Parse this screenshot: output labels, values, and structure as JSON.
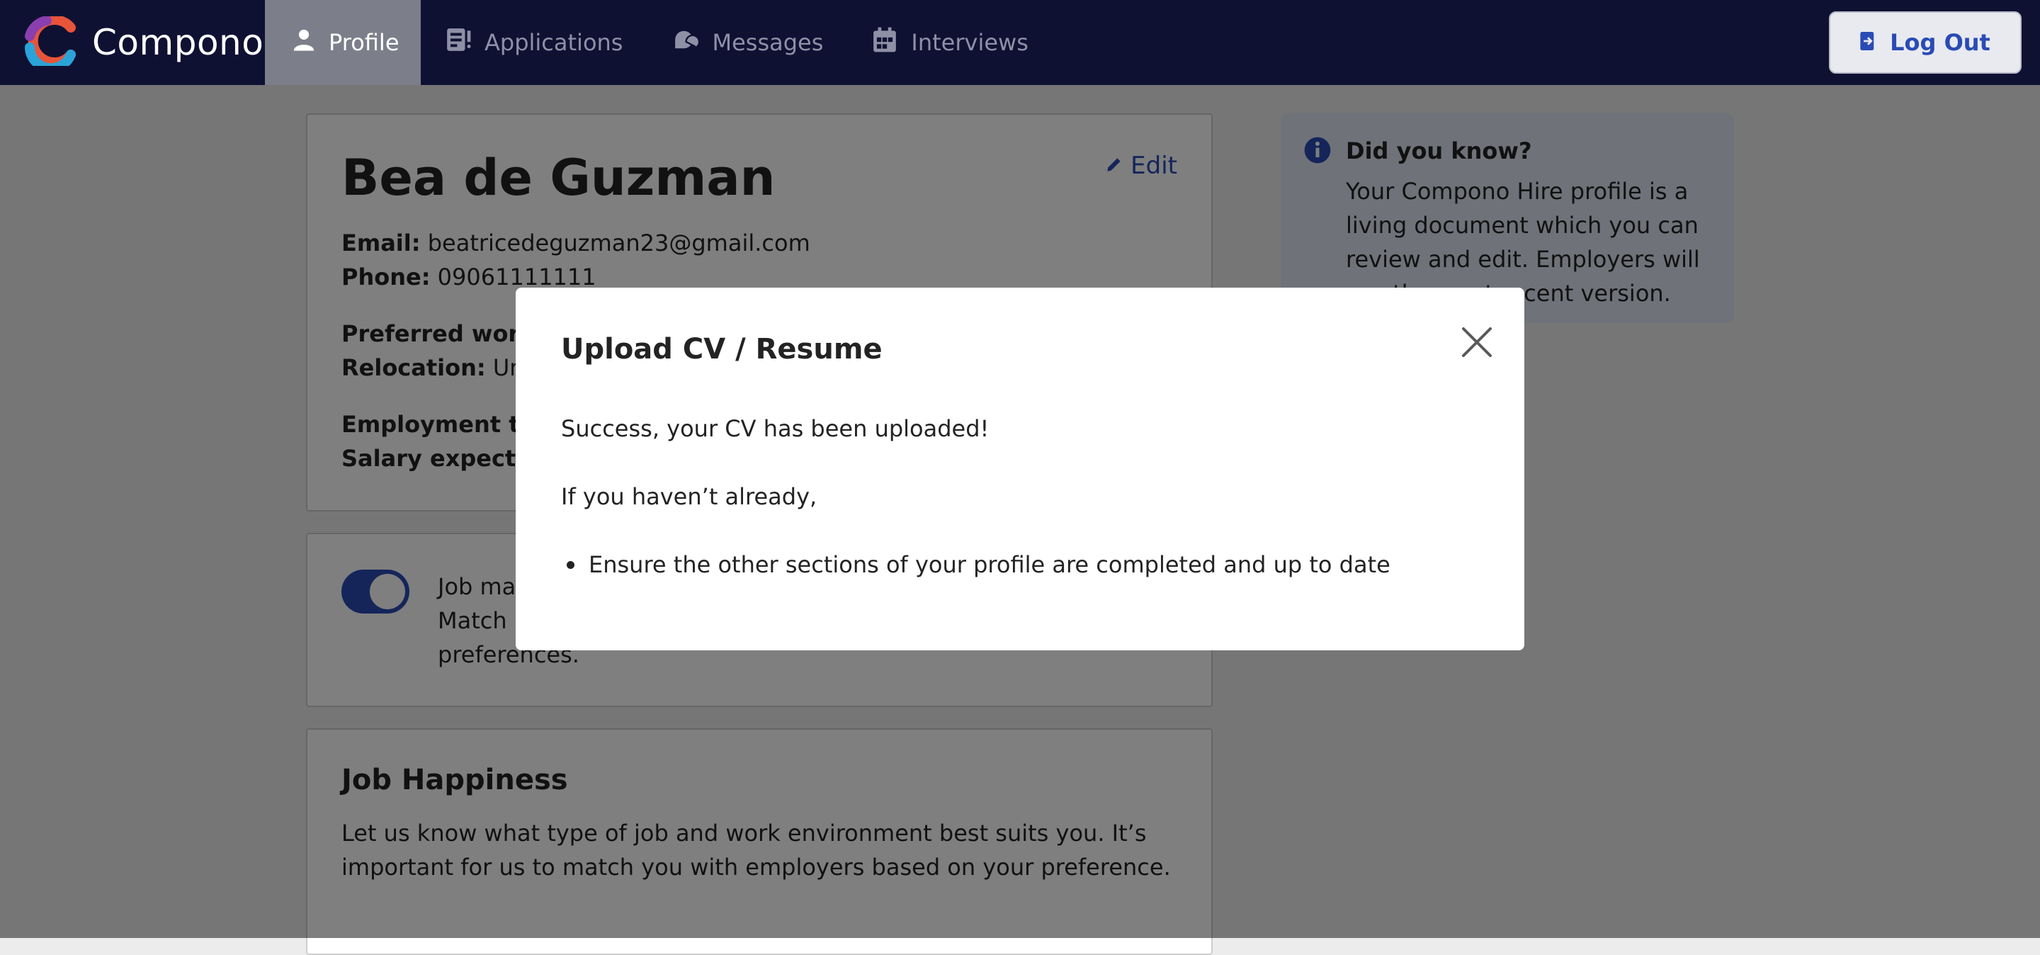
{
  "nav": {
    "brand": "Compono",
    "items": [
      {
        "label": "Profile",
        "icon": "person-icon",
        "active": true
      },
      {
        "label": "Applications",
        "icon": "document-list-icon",
        "active": false
      },
      {
        "label": "Messages",
        "icon": "chat-bubbles-icon",
        "active": false
      },
      {
        "label": "Interviews",
        "icon": "calendar-icon",
        "active": false
      }
    ],
    "logout_label": "Log Out"
  },
  "profile": {
    "name": "Bea de Guzman",
    "edit_label": "Edit",
    "email_label": "Email:",
    "email": "beatricedeguzman23@gmail.com",
    "phone_label": "Phone:",
    "phone": "09061111111",
    "preferred_location_label": "Preferred work l",
    "relocation_label": "Relocation:",
    "relocation_value": "Unw",
    "employment_label": "Employment typ",
    "salary_label": "Salary expectat"
  },
  "job_match": {
    "line1": "Job ma",
    "line2": "Match n",
    "line3": "preferences.",
    "enabled": true
  },
  "job_happiness": {
    "title": "Job Happiness",
    "text": "Let us know what type of job and work environment best suits you. It’s important for us to match you with employers based on your preference."
  },
  "info_box": {
    "title": "Did you know?",
    "text": "Your Compono Hire profile is a living document which you can review and edit. Employers will see the most recent version."
  },
  "modal": {
    "title": "Upload CV / Resume",
    "success": "Success, your CV has been uploaded!",
    "prompt": "If you haven’t already,",
    "bullets": [
      "Ensure the other sections of your profile are completed and up to date"
    ]
  },
  "colors": {
    "nav_bg": "#0f1133",
    "accent": "#2a4bb5",
    "info_bg": "#dfe5f2"
  }
}
